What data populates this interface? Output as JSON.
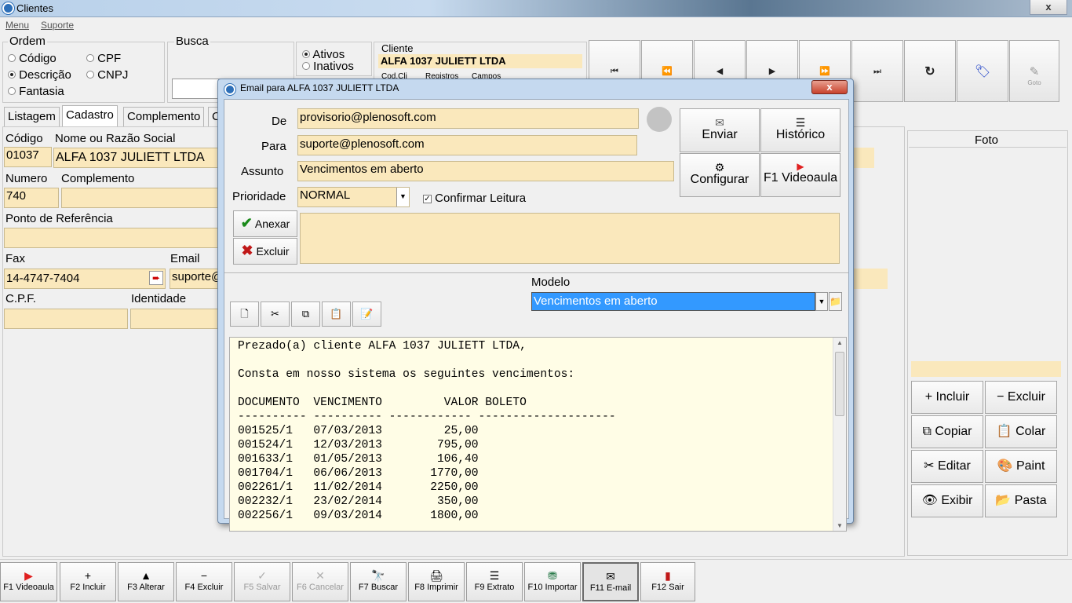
{
  "window": {
    "title": "Clientes",
    "close_label": "x"
  },
  "menu": [
    {
      "label": "Menu"
    },
    {
      "label": "Suporte"
    }
  ],
  "ordem": {
    "label": "Ordem",
    "options": [
      {
        "label": "Código",
        "selected": false
      },
      {
        "label": "CPF",
        "selected": false
      },
      {
        "label": "Descrição",
        "selected": true
      },
      {
        "label": "CNPJ",
        "selected": false
      },
      {
        "label": "Fantasia",
        "selected": false
      }
    ]
  },
  "busca": {
    "label": "Busca",
    "value": ""
  },
  "status_filter": {
    "options": [
      {
        "label": "Ativos",
        "selected": true
      },
      {
        "label": "Inativos",
        "selected": false
      }
    ]
  },
  "cliente_info": {
    "label": "Cliente",
    "value": "ALFA 1037 JULIETT LTDA",
    "cod_cli_label": "Cod.Cli",
    "registros_label": "Registros",
    "campos_label": "Campos"
  },
  "nav_buttons": [
    {
      "name": "first-record",
      "glyph": "⏮"
    },
    {
      "name": "prev-page",
      "glyph": "⏪"
    },
    {
      "name": "prev-record",
      "glyph": "◀"
    },
    {
      "name": "next-record",
      "glyph": "▶"
    },
    {
      "name": "next-page",
      "glyph": "⏩"
    },
    {
      "name": "last-record",
      "glyph": "⏭"
    },
    {
      "name": "refresh",
      "glyph": "↻"
    },
    {
      "name": "tag",
      "glyph": "🏷"
    },
    {
      "name": "goto",
      "glyph": "✎",
      "label": "Goto"
    }
  ],
  "tabs": [
    {
      "label": "Listagem"
    },
    {
      "label": "Cadastro"
    },
    {
      "label": "Complemento"
    },
    {
      "label": "C"
    }
  ],
  "form": {
    "codigo": {
      "label": "Código",
      "value": "01037"
    },
    "nome": {
      "label": "Nome ou Razão Social",
      "value": "ALFA 1037 JULIETT LTDA"
    },
    "numero": {
      "label": "Numero",
      "value": "740"
    },
    "complemento": {
      "label": "Complemento",
      "value": ""
    },
    "ponto_ref": {
      "label": "Ponto de Referência",
      "value": ""
    },
    "fax": {
      "label": "Fax",
      "value": "14-4747-7404"
    },
    "email": {
      "label": "Email",
      "value": "suporte@"
    },
    "cpf": {
      "label": "C.P.F.",
      "value": ""
    },
    "identidade": {
      "label": "Identidade",
      "value": ""
    }
  },
  "foto": {
    "label": "Foto"
  },
  "foto_buttons": [
    {
      "name": "incluir",
      "label": "Incluir",
      "icon": "+"
    },
    {
      "name": "excluir",
      "label": "Excluir",
      "icon": "−"
    },
    {
      "name": "copiar",
      "label": "Copiar",
      "icon": "⧉"
    },
    {
      "name": "colar",
      "label": "Colar",
      "icon": "📋"
    },
    {
      "name": "editar",
      "label": "Editar",
      "icon": "✂"
    },
    {
      "name": "paint",
      "label": "Paint",
      "icon": "🎨"
    },
    {
      "name": "exibir",
      "label": "Exibir",
      "icon": "👁"
    },
    {
      "name": "pasta",
      "label": "Pasta",
      "icon": "📂"
    }
  ],
  "dialog": {
    "title": "Email para ALFA 1037 JULIETT LTDA",
    "de": {
      "label": "De",
      "value": "provisorio@plenosoft.com"
    },
    "para": {
      "label": "Para",
      "value": "suporte@plenosoft.com"
    },
    "assunto": {
      "label": "Assunto",
      "value": "Vencimentos em aberto"
    },
    "prioridade": {
      "label": "Prioridade",
      "value": "NORMAL"
    },
    "confirmar_leitura": {
      "label": "Confirmar Leitura",
      "checked": true
    },
    "enviar": "Enviar",
    "historico": "Histórico",
    "configurar": "Configurar",
    "videoaula": "F1 Videoaula",
    "anexar": "Anexar",
    "excluir": "Excluir",
    "modelo": {
      "label": "Modelo",
      "value": "Vencimentos em aberto"
    },
    "body_text": "Prezado(a) cliente ALFA 1037 JULIETT LTDA,\n\nConsta em nosso sistema os seguintes vencimentos:\n\nDOCUMENTO  VENCIMENTO         VALOR BOLETO\n---------- ---------- ------------ --------------------\n001525/1   07/03/2013         25,00\n001524/1   12/03/2013        795,00\n001633/1   01/05/2013        106,40\n001704/1   06/06/2013       1770,00\n002261/1   11/02/2014       2250,00\n002232/1   23/02/2014        350,00\n002256/1   09/03/2014       1800,00"
  },
  "function_keys": [
    {
      "name": "f1",
      "label": "F1 Videoaula",
      "icon": "▶",
      "color": "#e02020",
      "disabled": false
    },
    {
      "name": "f2",
      "label": "F2 Incluir",
      "icon": "+",
      "color": "#000",
      "disabled": false
    },
    {
      "name": "f3",
      "label": "F3 Alterar",
      "icon": "▲",
      "color": "#000",
      "disabled": false
    },
    {
      "name": "f4",
      "label": "F4 Excluir",
      "icon": "−",
      "color": "#000",
      "disabled": false
    },
    {
      "name": "f5",
      "label": "F5 Salvar",
      "icon": "✓",
      "color": "#b0b0b0",
      "disabled": true
    },
    {
      "name": "f6",
      "label": "F6 Cancelar",
      "icon": "✕",
      "color": "#b0b0b0",
      "disabled": true
    },
    {
      "name": "f7",
      "label": "F7 Buscar",
      "icon": "🔭",
      "color": "#000",
      "disabled": false
    },
    {
      "name": "f8",
      "label": "F8 Imprimir",
      "icon": "🖨",
      "color": "#000",
      "disabled": false
    },
    {
      "name": "f9",
      "label": "F9 Extrato",
      "icon": "☰",
      "color": "#000",
      "disabled": false
    },
    {
      "name": "f10",
      "label": "F10 Importar",
      "icon": "⛃",
      "color": "#2a7a4a",
      "disabled": false
    },
    {
      "name": "f11",
      "label": "F11 E-mail",
      "icon": "✉",
      "color": "#000",
      "disabled": false,
      "pressed": true
    },
    {
      "name": "f12",
      "label": "F12 Sair",
      "icon": "▮",
      "color": "#c01818",
      "disabled": false
    }
  ]
}
